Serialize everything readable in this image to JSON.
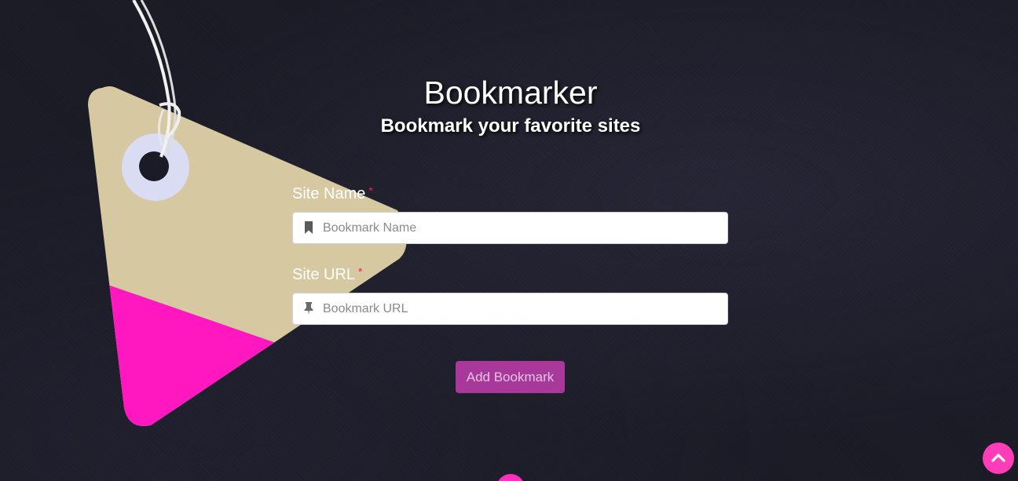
{
  "header": {
    "title": "Bookmarker",
    "subtitle": "Bookmark your favorite sites"
  },
  "form": {
    "site_name": {
      "label": "Site Name",
      "required_mark": "*",
      "placeholder": "Bookmark Name",
      "value": "",
      "icon": "bookmark-icon"
    },
    "site_url": {
      "label": "Site URL",
      "required_mark": "*",
      "placeholder": "Bookmark URL",
      "value": "",
      "icon": "thumbtack-icon"
    },
    "submit_label": "Add Bookmark"
  },
  "scroll_top": {
    "icon": "chevron-up-icon"
  },
  "colors": {
    "background": "#1b1b27",
    "accent": "#a8389a",
    "scroll_button": "#ff3db8",
    "tag_pink": "#ff18c0",
    "tag_kraft": "#d6c8a0",
    "required": "#ff1a55"
  }
}
